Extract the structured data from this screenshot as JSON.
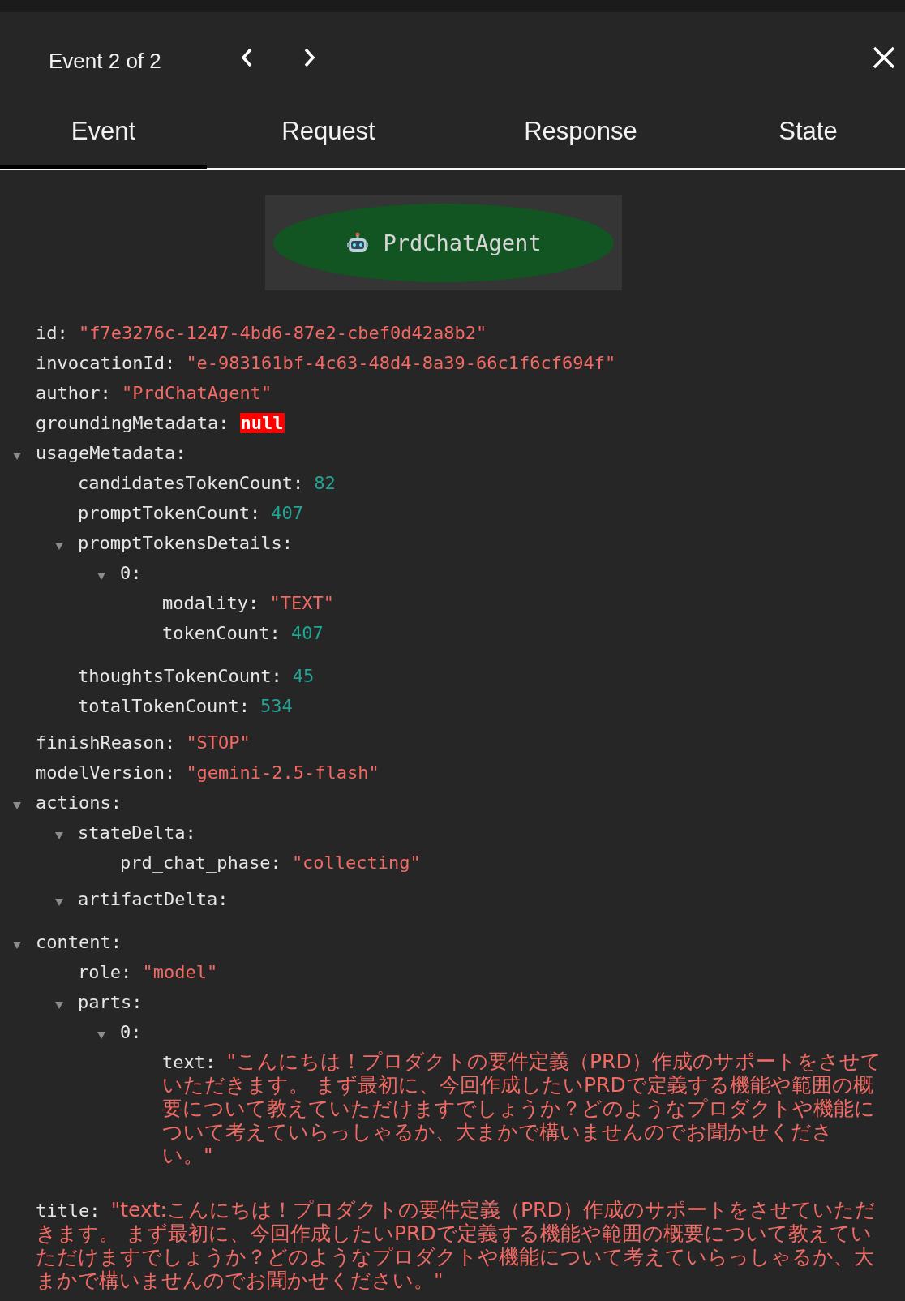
{
  "header": {
    "title": "Event 2 of 2"
  },
  "tabs": [
    {
      "label": "Event",
      "selected": true
    },
    {
      "label": "Request",
      "selected": false
    },
    {
      "label": "Response",
      "selected": false
    },
    {
      "label": "State",
      "selected": false
    }
  ],
  "agent_node": {
    "label": "PrdChatAgent"
  },
  "tree": [
    {
      "key": "id:",
      "value": "\"f7e3276c-1247-4bd6-87e2-cbef0d42a8b2\"",
      "kind": "string"
    },
    {
      "key": "invocationId:",
      "value": "\"e-983161bf-4c63-48d4-8a39-66c1f6cf694f\"",
      "kind": "string"
    },
    {
      "key": "author:",
      "value": "\"PrdChatAgent\"",
      "kind": "string"
    },
    {
      "key": "groundingMetadata:",
      "value": "null",
      "kind": "null"
    },
    {
      "key": "usageMetadata:",
      "kind": "object",
      "expanded": true,
      "children": [
        {
          "key": "candidatesTokenCount:",
          "value": "82",
          "kind": "number"
        },
        {
          "key": "promptTokenCount:",
          "value": "407",
          "kind": "number"
        },
        {
          "key": "promptTokensDetails:",
          "kind": "object",
          "expanded": true,
          "children": [
            {
              "key": "0:",
              "kind": "object",
              "expanded": true,
              "children": [
                {
                  "key": "modality:",
                  "value": "\"TEXT\"",
                  "kind": "string"
                },
                {
                  "key": "tokenCount:",
                  "value": "407",
                  "kind": "number"
                }
              ]
            }
          ]
        },
        {
          "key": "thoughtsTokenCount:",
          "value": "45",
          "kind": "number"
        },
        {
          "key": "totalTokenCount:",
          "value": "534",
          "kind": "number"
        }
      ]
    },
    {
      "key": "finishReason:",
      "value": "\"STOP\"",
      "kind": "string"
    },
    {
      "key": "modelVersion:",
      "value": "\"gemini-2.5-flash\"",
      "kind": "string"
    },
    {
      "key": "actions:",
      "kind": "object",
      "expanded": true,
      "children": [
        {
          "key": "stateDelta:",
          "kind": "object",
          "expanded": true,
          "children": [
            {
              "key": "prd_chat_phase:",
              "value": "\"collecting\"",
              "kind": "string"
            }
          ]
        },
        {
          "key": "artifactDelta:",
          "kind": "object",
          "expanded": true
        }
      ]
    },
    {
      "key": "content:",
      "kind": "object",
      "expanded": true,
      "children": [
        {
          "key": "role:",
          "value": "\"model\"",
          "kind": "string"
        },
        {
          "key": "parts:",
          "kind": "object",
          "expanded": true,
          "children": [
            {
              "key": "0:",
              "kind": "object",
              "expanded": true,
              "children": [
                {
                  "key": "text:",
                  "value": "\"こんにちは！プロダクトの要件定義（PRD）作成のサポートをさせていただきます。 まず最初に、今回作成したいPRDで定義する機能や範囲の概要について教えていただけますでしょうか？どのようなプロダクトや機能について考えていらっしゃるか、大まかで構いませんのでお聞かせください。\"",
                  "kind": "longstring"
                }
              ]
            }
          ]
        }
      ]
    },
    {
      "key": "title:",
      "value": "\"text:こんにちは！プロダクトの要件定義（PRD）作成のサポートをさせていただきます。 まず最初に、今回作成したいPRDで定義する機能や範囲の概要について教えていただけますでしょうか？どのようなプロダクトや機能について考えていらっしゃるか、大まかで構いませんのでお聞かせください。\"",
      "kind": "longstring"
    }
  ]
}
